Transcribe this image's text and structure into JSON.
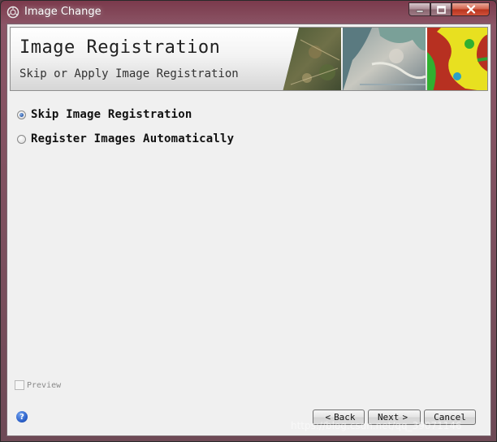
{
  "window": {
    "title": "Image Change",
    "title_icon": "app-icon",
    "controls": {
      "minimize_icon": "minimize-icon",
      "maximize_icon": "maximize-icon",
      "close_icon": "close-icon"
    }
  },
  "header": {
    "title": "Image Registration",
    "subtitle": "Skip or Apply Image Registration",
    "art": "satellite-imagery-banner"
  },
  "options": [
    {
      "label": "Skip Image Registration",
      "checked": true
    },
    {
      "label": "Register Images Automatically",
      "checked": false
    }
  ],
  "preview": {
    "label": "Preview",
    "checked": false
  },
  "help": {
    "icon": "help-icon",
    "glyph": "?"
  },
  "buttons": {
    "back": "Back",
    "back_glyph": "<",
    "next": "Next",
    "next_glyph": ">",
    "cancel": "Cancel"
  },
  "watermark": "https://blog.csdn.net/qq_39071146",
  "colors": {
    "window_frame": "#7b3a4c",
    "close_button": "#c8402a",
    "client_bg": "#f0f0f0",
    "radio_selected": "#2a5aa8"
  }
}
